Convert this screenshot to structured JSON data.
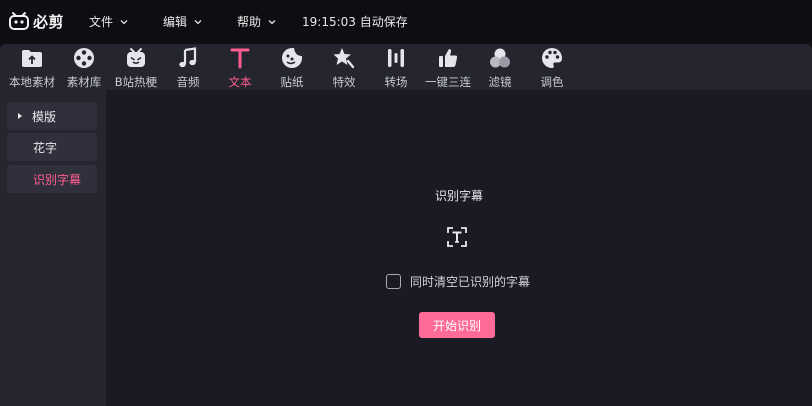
{
  "app": {
    "name": "必剪"
  },
  "menu": [
    {
      "label": "文件"
    },
    {
      "label": "编辑"
    },
    {
      "label": "帮助"
    }
  ],
  "save_status": "19:15:03 自动保存",
  "toolbar": {
    "items": [
      {
        "label": "本地素材",
        "icon": "folder-upload-icon"
      },
      {
        "label": "素材库",
        "icon": "film-reel-icon"
      },
      {
        "label": "B站热梗",
        "icon": "tv-mascot-icon"
      },
      {
        "label": "音频",
        "icon": "music-note-icon"
      },
      {
        "label": "文本",
        "icon": "text-t-icon",
        "active": true
      },
      {
        "label": "贴纸",
        "icon": "sticker-face-icon"
      },
      {
        "label": "特效",
        "icon": "sparkle-star-icon"
      },
      {
        "label": "转场",
        "icon": "transition-bars-icon"
      },
      {
        "label": "一键三连",
        "icon": "thumbs-up-icon"
      },
      {
        "label": "滤镜",
        "icon": "filter-circles-icon"
      },
      {
        "label": "调色",
        "icon": "palette-icon"
      }
    ],
    "active_color": "#ff5f8f"
  },
  "sidebar": {
    "items": [
      {
        "label": "模版",
        "expandable": true
      },
      {
        "label": "花字"
      },
      {
        "label": "识别字幕",
        "active": true
      }
    ]
  },
  "panel": {
    "title": "识别字幕",
    "checkbox_label": "同时清空已识别的字幕",
    "checkbox_checked": false,
    "start_button": "开始识别",
    "accent": "#ff6a96"
  }
}
